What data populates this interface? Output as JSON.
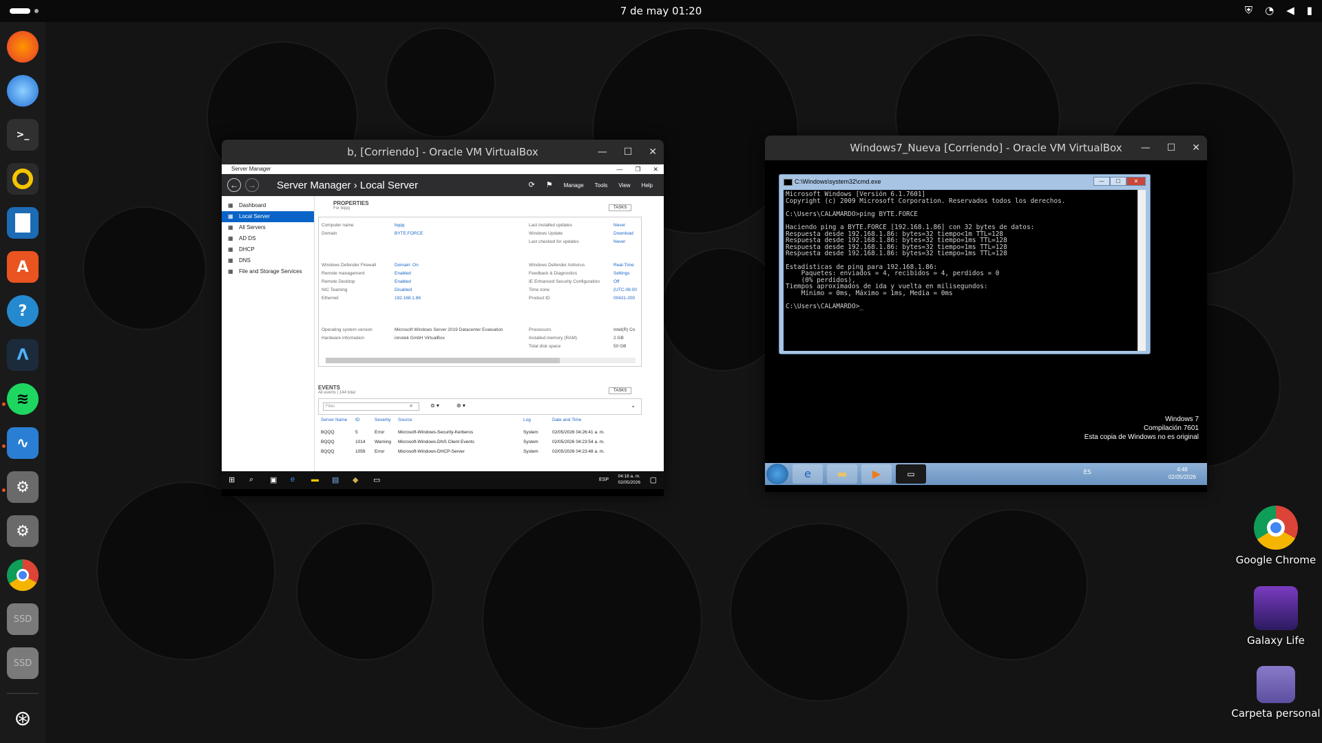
{
  "topbar": {
    "clock": "7 de may  01:20",
    "tray_icons": [
      "shield-icon",
      "wifi-icon",
      "volume-icon",
      "battery-icon"
    ]
  },
  "dock": {
    "items": [
      {
        "name": "firefox",
        "color": "#e66000"
      },
      {
        "name": "thunderbird",
        "color": "#2f7de0"
      },
      {
        "name": "terminal",
        "color": "#303030"
      },
      {
        "name": "rhythmbox",
        "color": "#2b2b2b"
      },
      {
        "name": "writer",
        "color": "#1c6bb5"
      },
      {
        "name": "app-center",
        "color": "#e95420"
      },
      {
        "name": "help",
        "color": "#2589d0"
      },
      {
        "name": "arduino",
        "color": "#1c2b3c"
      },
      {
        "name": "spotify",
        "color": "#1ed760"
      },
      {
        "name": "system-monitor",
        "color": "#2a7fd4"
      },
      {
        "name": "settings",
        "color": "#6a6a6a"
      },
      {
        "name": "settings-2",
        "color": "#6a6a6a"
      },
      {
        "name": "chrome",
        "color": "#4285f4"
      },
      {
        "name": "ssd-1",
        "color": "#7a7a7a"
      },
      {
        "name": "ssd-2",
        "color": "#7a7a7a"
      },
      {
        "name": "ubuntu",
        "color": "#111"
      }
    ],
    "terminal_glyph": ">_",
    "ssd_label": "SSD"
  },
  "desktop": {
    "icons": [
      {
        "label": "Google Chrome"
      },
      {
        "label": "Galaxy Life"
      },
      {
        "label": "Carpeta personal"
      }
    ]
  },
  "vm1": {
    "title": "b, [Corriendo] - Oracle VM VirtualBox",
    "app_title": "Server Manager",
    "breadcrumb": "Server Manager  ›  Local Server",
    "menu": [
      "Manage",
      "Tools",
      "View",
      "Help"
    ],
    "sidebar": [
      "Dashboard",
      "Local Server",
      "All Servers",
      "AD DS",
      "DHCP",
      "DNS",
      "File and Storage Services"
    ],
    "properties": {
      "heading": "PROPERTIES",
      "sub": "For bqqq",
      "tasks": "TASKS",
      "rows": [
        {
          "label": "Computer name",
          "value": "bqqq",
          "rlabel": "Last installed updates",
          "rvalue": "Never"
        },
        {
          "label": "Domain",
          "value": "BYTE.FORCE",
          "rlabel": "Windows Update",
          "rvalue": "Download"
        },
        {
          "label": "",
          "value": "",
          "rlabel": "Last checked for updates",
          "rvalue": "Never"
        },
        {
          "label": "Windows Defender Firewall",
          "value": "Domain: On",
          "rlabel": "Windows Defender Antivirus",
          "rvalue": "Real-Time"
        },
        {
          "label": "Remote management",
          "value": "Enabled",
          "rlabel": "Feedback & Diagnostics",
          "rvalue": "Settings"
        },
        {
          "label": "Remote Desktop",
          "value": "Enabled",
          "rlabel": "IE Enhanced Security Configuration",
          "rvalue": "Off"
        },
        {
          "label": "NIC Teaming",
          "value": "Disabled",
          "rlabel": "Time zone",
          "rvalue": "(UTC-06:00"
        },
        {
          "label": "Ethernet",
          "value": "192.168.1.86",
          "rlabel": "Product ID",
          "rvalue": "00431-200"
        },
        {
          "label": "Operating system version",
          "value": "Microsoft Windows Server 2019 Datacenter Evaluation",
          "rlabel": "Processors",
          "rvalue": "Intel(R) Co"
        },
        {
          "label": "Hardware information",
          "value": "innotek GmbH VirtualBox",
          "rlabel": "Installed memory (RAM)",
          "rvalue": "2 GB"
        },
        {
          "label": "",
          "value": "",
          "rlabel": "Total disk space",
          "rvalue": "50 GB"
        }
      ]
    },
    "events": {
      "heading": "EVENTS",
      "sub": "All events | 144 total",
      "tasks": "TASKS",
      "filter_placeholder": "Filter",
      "columns": [
        "Server Name",
        "ID",
        "Severity",
        "Source",
        "Log",
        "Date and Time"
      ],
      "rows": [
        [
          "BQQQ",
          "5",
          "Error",
          "Microsoft-Windows-Security-Kerberos",
          "System",
          "02/05/2026 04:26:41 a. m."
        ],
        [
          "BQQQ",
          "1014",
          "Warning",
          "Microsoft-Windows-DNS Client Events",
          "System",
          "02/05/2026 04:23:54 a. m."
        ],
        [
          "BQQQ",
          "1059",
          "Error",
          "Microsoft-Windows-DHCP-Server",
          "System",
          "02/05/2026 04:23:48 a. m."
        ]
      ]
    },
    "taskbar": {
      "lang": "ESP",
      "time": "04:18 a. m.",
      "date": "02/05/2026"
    }
  },
  "vm2": {
    "title": "Windows7_Nueva [Corriendo] - Oracle VM VirtualBox",
    "cmd_title": "C:\\Windows\\system32\\cmd.exe",
    "cmd_output": "Microsoft Windows [Versión 6.1.7601]\nCopyright (c) 2009 Microsoft Corporation. Reservados todos los derechos.\n\nC:\\Users\\CALAMARDO>ping BYTE.FORCE\n\nHaciendo ping a BYTE.FORCE [192.168.1.86] con 32 bytes de datos:\nRespuesta desde 192.168.1.86: bytes=32 tiempo<1m TTL=128\nRespuesta desde 192.168.1.86: bytes=32 tiempo=1ms TTL=128\nRespuesta desde 192.168.1.86: bytes=32 tiempo=1ms TTL=128\nRespuesta desde 192.168.1.86: bytes=32 tiempo=1ms TTL=128\n\nEstadísticas de ping para 192.168.1.86:\n    Paquetes: enviados = 4, recibidos = 4, perdidos = 0\n    (0% perdidos),\nTiempos aproximados de ida y vuelta en milisegundos:\n    Mínimo = 0ms, Máximo = 1ms, Media = 0ms\n\nC:\\Users\\CALAMARDO>_",
    "watermark": [
      "Windows 7",
      "Compilación 7601",
      "Esta copia de Windows no es original"
    ],
    "taskbar": {
      "lang": "ES",
      "time": "4:48",
      "date": "02/05/2026"
    }
  }
}
